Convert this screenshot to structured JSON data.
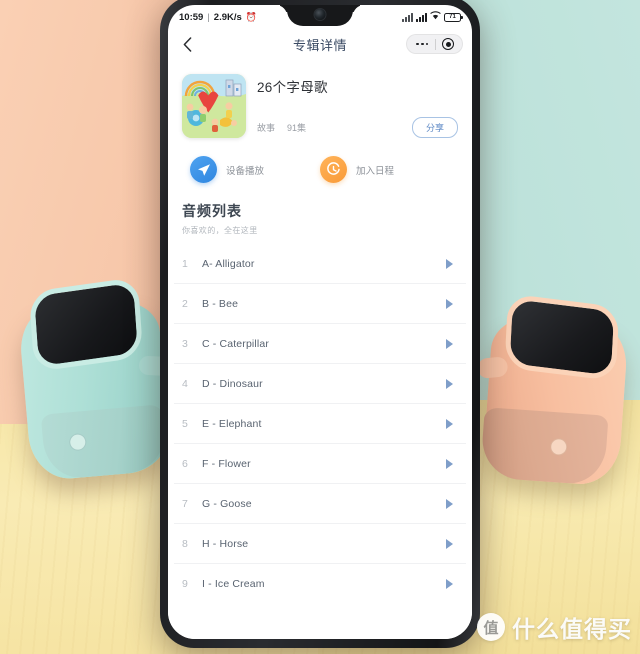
{
  "statusbar": {
    "time": "10:59",
    "separator": "|",
    "netspeed": "2.9K/s",
    "alarm_icon": "alarm-clock-icon",
    "signal_icon_1": "signal-roaming-icon",
    "signal_icon_2": "signal-bars-icon",
    "wifi_icon": "wifi-icon",
    "battery_level": "71"
  },
  "navbar": {
    "back_icon": "back-chevron-icon",
    "title": "专辑详情",
    "more_icon": "more-dots-icon",
    "target_icon": "target-circle-icon"
  },
  "album": {
    "cover_alt": "album-cover-illustration",
    "title": "26个字母歌",
    "category": "故事",
    "episodes": "91集",
    "share_label": "分享"
  },
  "actions": [
    {
      "icon": "send-play-icon",
      "label": "设备播放",
      "color": "#2f86e0"
    },
    {
      "icon": "clock-schedule-icon",
      "label": "加入日程",
      "color": "#f99a38"
    }
  ],
  "section": {
    "title": "音频列表",
    "subtitle": "你喜欢的，全在这里"
  },
  "tracks": [
    {
      "num": "1",
      "name": "A- Alligator",
      "play_icon": "play-triangle-icon"
    },
    {
      "num": "2",
      "name": "B - Bee",
      "play_icon": "play-triangle-icon"
    },
    {
      "num": "3",
      "name": "C - Caterpillar",
      "play_icon": "play-triangle-icon"
    },
    {
      "num": "4",
      "name": "D - Dinosaur",
      "play_icon": "play-triangle-icon"
    },
    {
      "num": "5",
      "name": "E - Elephant",
      "play_icon": "play-triangle-icon"
    },
    {
      "num": "6",
      "name": "F - Flower",
      "play_icon": "play-triangle-icon"
    },
    {
      "num": "7",
      "name": "G - Goose",
      "play_icon": "play-triangle-icon"
    },
    {
      "num": "8",
      "name": "H - Horse",
      "play_icon": "play-triangle-icon"
    },
    {
      "num": "9",
      "name": "I - Ice Cream",
      "play_icon": "play-triangle-icon"
    }
  ],
  "watermark": {
    "logo_char": "值",
    "text": "什么值得买"
  },
  "scene": {
    "left_wall_color": "#f7c9ac",
    "right_wall_color": "#bde2da",
    "table_color": "#f8eab0",
    "left_speaker_color": "#b4dfd6",
    "right_speaker_color": "#f9c4a5"
  }
}
